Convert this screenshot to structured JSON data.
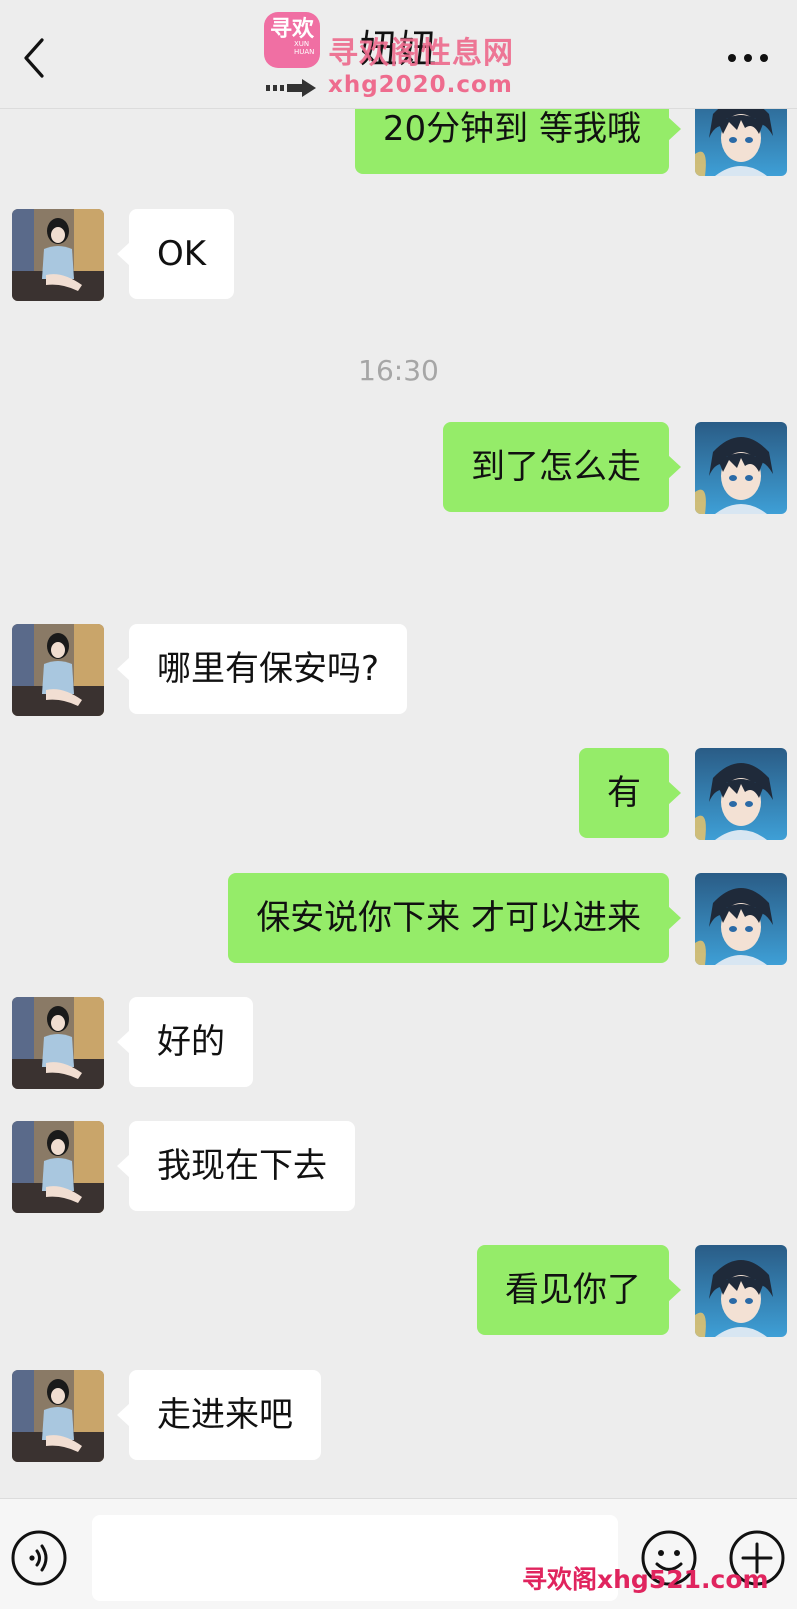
{
  "header": {
    "title": "妞妞",
    "back_icon": "chevron-left-icon",
    "more_icon": "ellipsis-icon"
  },
  "watermark_top": {
    "logo_text": "寻欢",
    "logo_sub": "XUN HUAN",
    "name": "寻欢阁性息网",
    "url": "xhg2020.com"
  },
  "watermark_bottom": {
    "text": "寻欢阁xhg521.com"
  },
  "timestamp": "16:30",
  "messages": [
    {
      "side": "out",
      "text": "20分钟到 等我哦"
    },
    {
      "side": "in",
      "text": "OK"
    },
    {
      "side": "out",
      "text": "到了怎么走"
    },
    {
      "side": "in",
      "text": "哪里有保安吗?"
    },
    {
      "side": "out",
      "text": "有"
    },
    {
      "side": "out",
      "text": "保安说你下来 才可以进来"
    },
    {
      "side": "in",
      "text": "好的"
    },
    {
      "side": "in",
      "text": "我现在下去"
    },
    {
      "side": "out",
      "text": "看见你了"
    },
    {
      "side": "in",
      "text": "走进来吧"
    }
  ],
  "input_bar": {
    "voice_icon": "voice-icon",
    "emoji_icon": "emoji-icon",
    "plus_icon": "plus-icon",
    "input_value": ""
  },
  "colors": {
    "background": "#ededed",
    "outgoing_bubble": "#95ec69",
    "incoming_bubble": "#ffffff",
    "watermark": "#ee6c8e"
  }
}
